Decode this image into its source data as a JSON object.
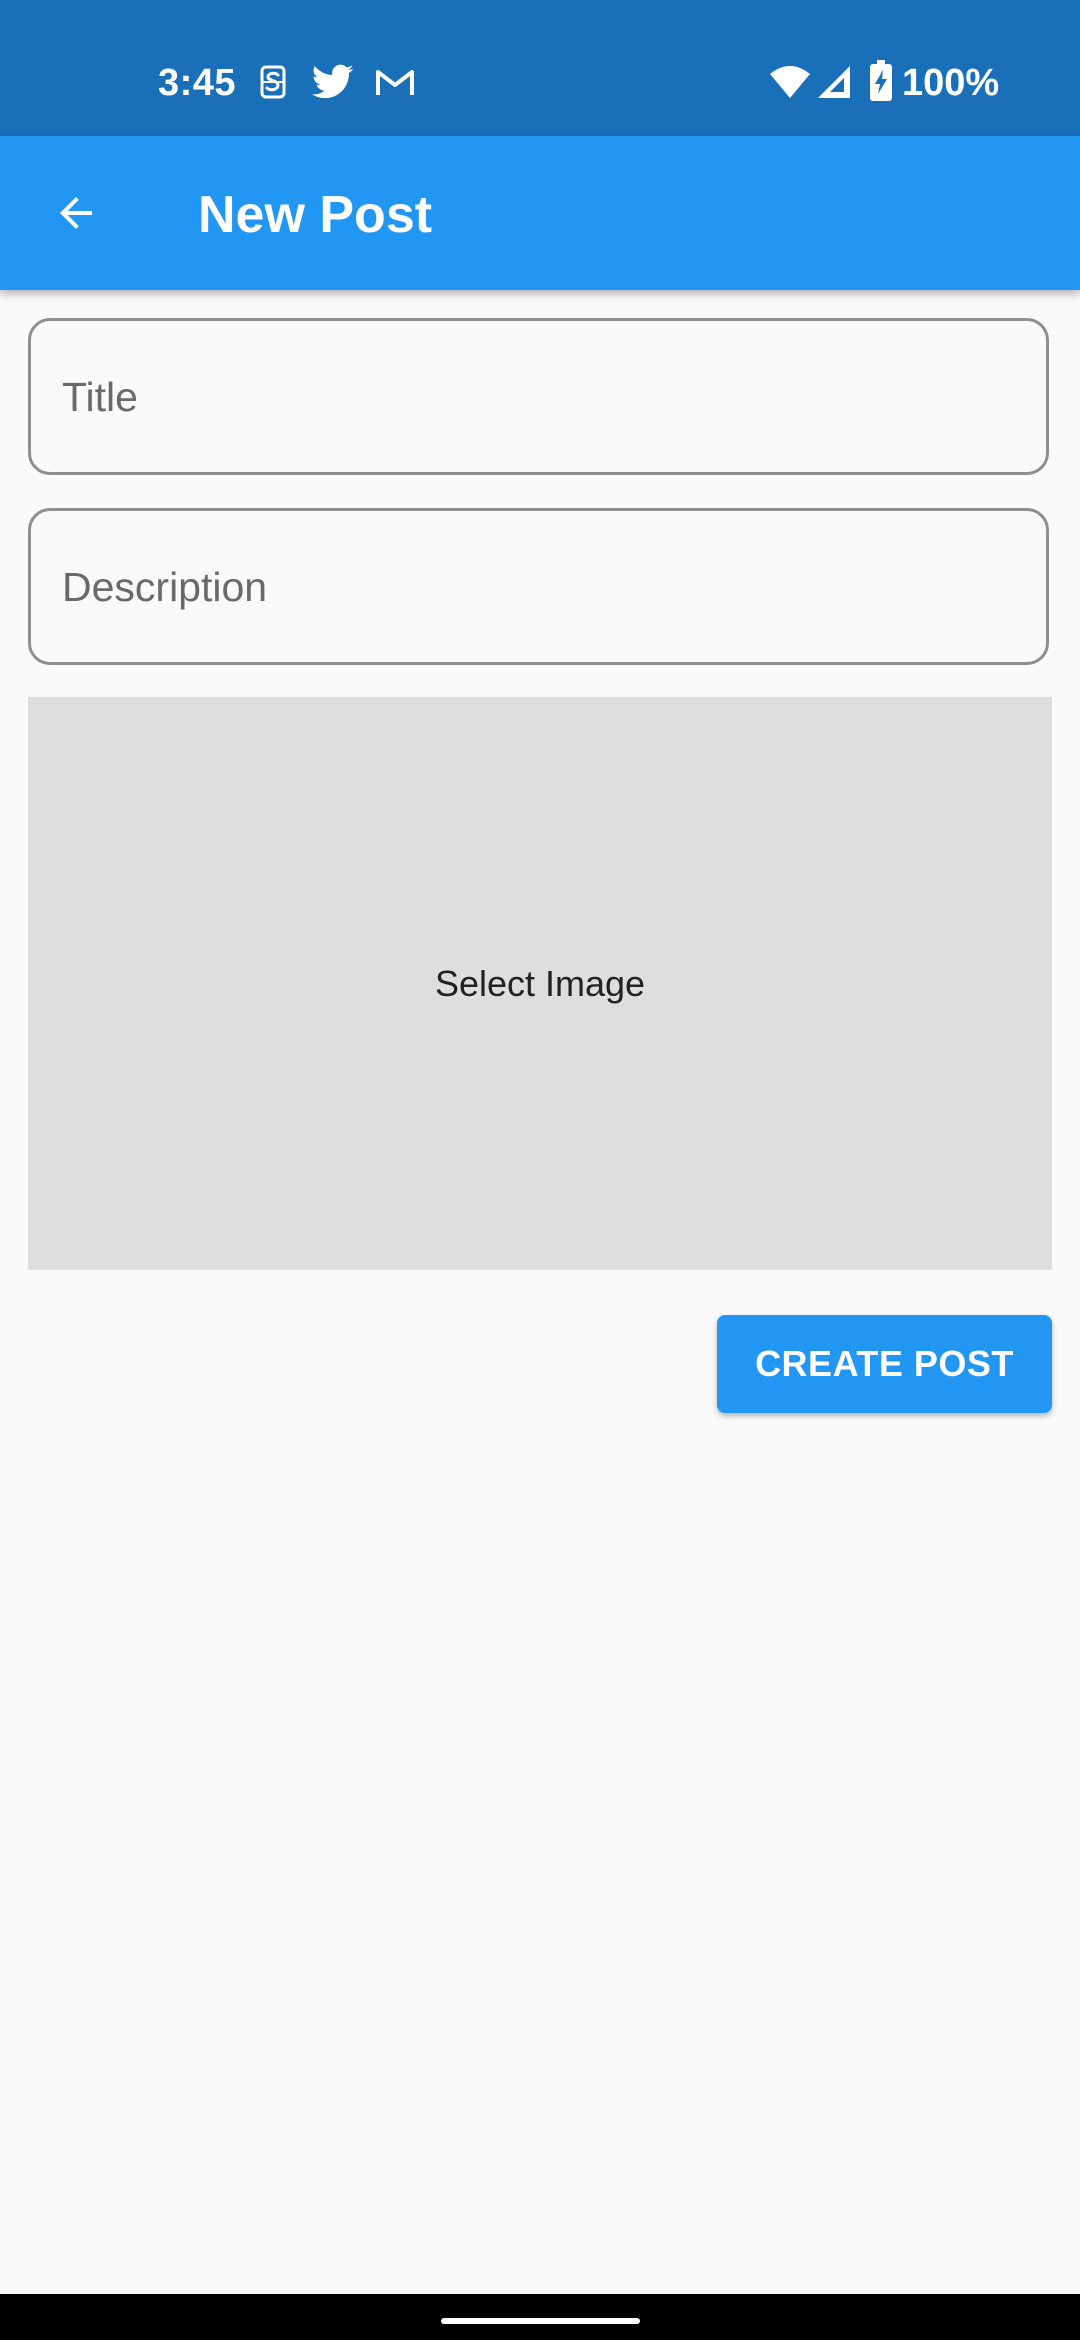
{
  "status_bar": {
    "time": "3:45",
    "battery_percent": "100%",
    "notification_icons": [
      "s-app-icon",
      "twitter-icon",
      "gmail-icon"
    ],
    "system_icons": [
      "wifi-icon",
      "cellular-signal-icon",
      "battery-charging-icon"
    ]
  },
  "app_bar": {
    "title": "New Post",
    "back_icon": "arrow-back-icon"
  },
  "form": {
    "title_field": {
      "placeholder": "Title",
      "value": ""
    },
    "description_field": {
      "placeholder": "Description",
      "value": ""
    },
    "image_picker_label": "Select Image",
    "submit_label": "CREATE POST"
  },
  "colors": {
    "status_bar": "#1A70B8",
    "app_bar": "#2196F3",
    "button": "#2196F3",
    "background": "#FAFAFA",
    "image_placeholder": "#DEDEDE"
  }
}
